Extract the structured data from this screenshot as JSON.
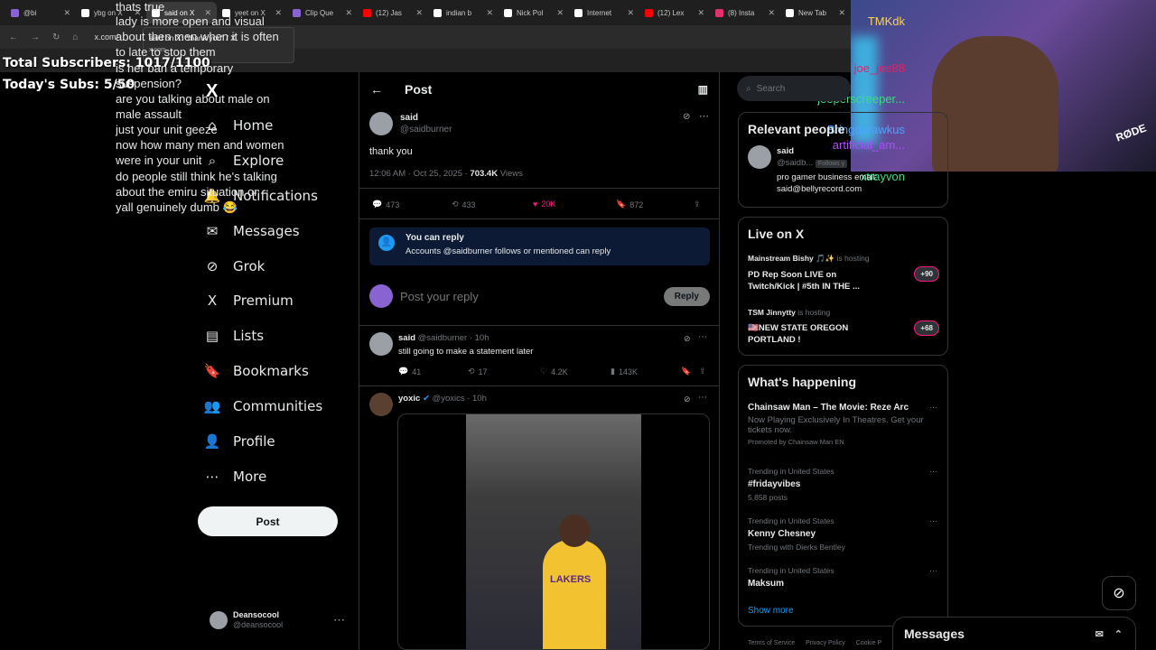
{
  "tabs": [
    {
      "title": "@bi",
      "color": "#8a63d2"
    },
    {
      "title": "ybg on X",
      "color": "#ffffff"
    },
    {
      "title": "said on X",
      "color": "#ffffff",
      "active": true
    },
    {
      "title": "yeet on X",
      "color": "#ffffff"
    },
    {
      "title": "Clip Que",
      "color": "#8a63d2"
    },
    {
      "title": "(12) Jas",
      "color": "#ff0000"
    },
    {
      "title": "indian b",
      "color": "#ffffff"
    },
    {
      "title": "Nick Pol",
      "color": "#ffffff"
    },
    {
      "title": "Internet",
      "color": "#ffffff"
    },
    {
      "title": "(12) Lex",
      "color": "#ff0000"
    },
    {
      "title": "(8) Insta",
      "color": "#e1306c"
    },
    {
      "title": "New Tab",
      "color": "#ffffff"
    }
  ],
  "address": {
    "url": "x.com/"
  },
  "tooltip": {
    "title": "said on X: \"thank you\" / X",
    "domain": "x.com"
  },
  "overlay": {
    "subs_total": "Total Subscribers: 1017/1100",
    "subs_today": "Today's Subs: 5/50"
  },
  "webcam": {
    "mic_brand": "RØDE"
  },
  "nav": {
    "logo": "X",
    "items": [
      {
        "label": "Home",
        "icon": "⌂"
      },
      {
        "label": "Explore",
        "icon": "⌕"
      },
      {
        "label": "Notifications",
        "icon": "🔔"
      },
      {
        "label": "Messages",
        "icon": "✉"
      },
      {
        "label": "Grok",
        "icon": "⊘"
      },
      {
        "label": "Premium",
        "icon": "X"
      },
      {
        "label": "Lists",
        "icon": "▤"
      },
      {
        "label": "Bookmarks",
        "icon": "🔖"
      },
      {
        "label": "Communities",
        "icon": "👥"
      },
      {
        "label": "Profile",
        "icon": "👤"
      },
      {
        "label": "More",
        "icon": "⋯"
      }
    ],
    "post_label": "Post",
    "account_name": "Deansocool",
    "account_handle": "@deansocool"
  },
  "chat": [
    {
      "user": "",
      "msg": [
        "thats true"
      ]
    },
    {
      "user": "TMKdk",
      "color": "#ffd24d",
      "msg": [
        "lady is more open and visual",
        "about then men when it is often",
        "to late to stop them"
      ]
    },
    {
      "user": "joe_joe88",
      "color": "#e91e63",
      "msg": [
        "is her ban a temporary",
        "suspension?"
      ]
    },
    {
      "user": "jeeperscreeper...",
      "color": "#3ddc84",
      "msg": [
        "are you talking about male on",
        "male assault"
      ]
    },
    {
      "user": "Bringdarawkus",
      "color": "#4fa3ff",
      "msg": [
        "just your unit geeze"
      ]
    },
    {
      "user": "artificial_am...",
      "color": "#b04cff",
      "msg": [
        "now how many men and women",
        "were in your unit"
      ]
    },
    {
      "user": "xtrayvon",
      "color": "#3ddc84",
      "msg": [
        "do people still think he's talking",
        "about the emiru situation or",
        "yall genuinely dumb 😂"
      ]
    }
  ],
  "main": {
    "header": "Post",
    "tweet": {
      "name": "said",
      "handle": "@saidburner",
      "text": "thank you",
      "meta": "12:06 AM · Oct 25, 2025 · ",
      "views": "703.4K",
      "views_label": "Views",
      "replies": "473",
      "reposts": "433",
      "likes": "20K",
      "bookmarks": "872"
    },
    "reply_notice": {
      "title": "You can reply",
      "body": "Accounts @saidburner follows or mentioned can reply"
    },
    "compose": {
      "placeholder": "Post your reply",
      "button": "Reply"
    },
    "reply1": {
      "name": "said",
      "meta": "@saidburner · 10h",
      "text": "still going to make a statement later",
      "replies": "41",
      "reposts": "17",
      "likes": "4.2K",
      "views": "143K"
    },
    "reply2": {
      "name": "yoxic",
      "meta": "@yoxics · 10h",
      "jersey": "LAKERS"
    }
  },
  "sidebar": {
    "search_placeholder": "Search",
    "relevant": {
      "title": "Relevant people",
      "name": "said",
      "handle": "@saidb...",
      "follows_badge": "Follows y",
      "bio": "pro gamer business email: said@bellyrecord.com"
    },
    "live": {
      "title": "Live on X",
      "items": [
        {
          "host": "Mainstream Bishy 🎵✨",
          "status": "is hosting",
          "title": "PD Rep Soon LIVE on Twitch/Kick | #5th IN THE ...",
          "count": "+90"
        },
        {
          "host": "TSM Jinnytty",
          "status": "is hosting",
          "title": "🇺🇸NEW STATE OREGON PORTLAND !",
          "count": "+68"
        }
      ]
    },
    "happening": {
      "title": "What's happening",
      "promo": {
        "name": "Chainsaw Man – The Movie: Reze Arc",
        "desc": "Now Playing Exclusively In Theatres. Get your tickets now.",
        "tag": "Promoted by Chainsaw Man EN"
      },
      "trends": [
        {
          "context": "Trending in United States",
          "name": "#fridayvibes",
          "sub": "5,858 posts"
        },
        {
          "context": "Trending in United States",
          "name": "Kenny Chesney",
          "sub": "Trending with Dierks Bentley"
        },
        {
          "context": "Trending in United States",
          "name": "Maksum",
          "sub": ""
        }
      ],
      "show_more": "Show more"
    },
    "footer": [
      "Terms of Service",
      "Privacy Policy",
      "Cookie P"
    ]
  },
  "messages_bar": {
    "label": "Messages"
  }
}
